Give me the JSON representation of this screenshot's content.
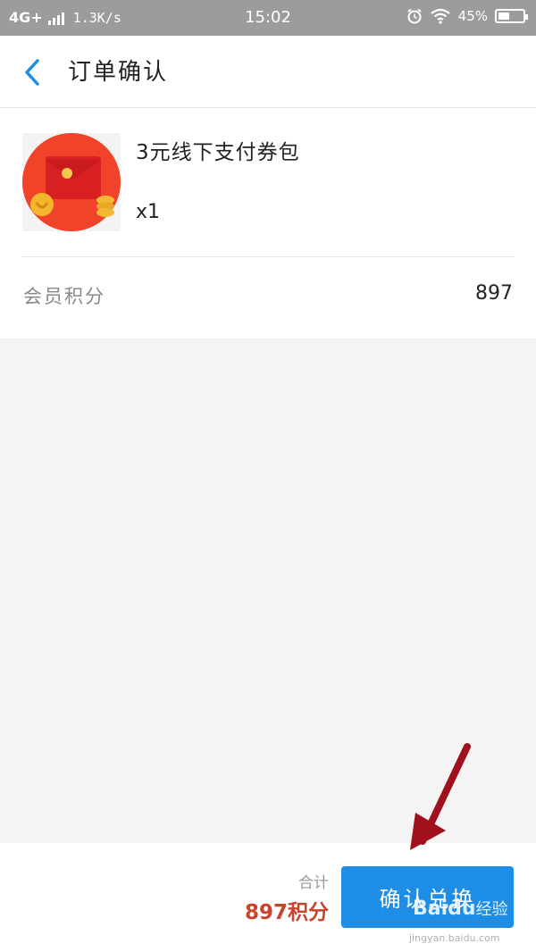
{
  "status_bar": {
    "network": "4G+",
    "speed": "1.3K/s",
    "time": "15:02",
    "battery": "45%",
    "battery_level": 0.45
  },
  "header": {
    "title": "订单确认",
    "back_icon": "chevron-left-icon"
  },
  "product": {
    "name": "3元线下支付券包",
    "quantity": "x1",
    "image_icon": "red-envelope-icon"
  },
  "points": {
    "label": "会员积分",
    "value": "897"
  },
  "footer": {
    "total_label": "合计",
    "total_value": "897积分",
    "confirm_label": "确认兑换"
  },
  "watermark": {
    "brand": "Baidu",
    "suffix": "经验",
    "url": "jingyan.baidu.com"
  },
  "colors": {
    "accent": "#1e8de6",
    "price": "#c8442c",
    "statusbar": "#9c9c9c",
    "annotation_arrow": "#a0111d"
  }
}
